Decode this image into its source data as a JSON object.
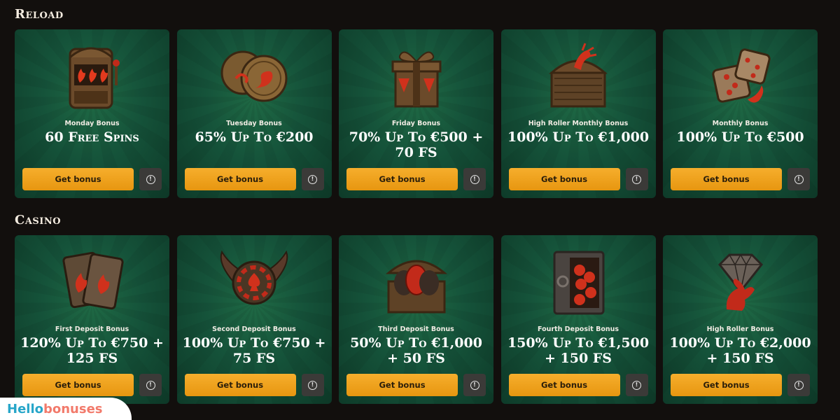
{
  "sections": [
    {
      "title": "Reload",
      "cards": [
        {
          "label": "Monday Bonus",
          "offer": "60 Free Spins",
          "button": "Get bonus",
          "icon": "slot-machine-icon"
        },
        {
          "label": "Tuesday Bonus",
          "offer": "65% Up To €200",
          "button": "Get bonus",
          "icon": "dragon-coins-icon"
        },
        {
          "label": "Friday Bonus",
          "offer": "70% Up To €500 + 70 FS",
          "button": "Get bonus",
          "icon": "gift-box-icon"
        },
        {
          "label": "High Roller Monthly Bonus",
          "offer": "100% Up To €1,000",
          "button": "Get bonus",
          "icon": "treasure-chest-claw-icon"
        },
        {
          "label": "Monthly Bonus",
          "offer": "100% Up To €500",
          "button": "Get bonus",
          "icon": "dice-icon"
        }
      ]
    },
    {
      "title": "Casino",
      "cards": [
        {
          "label": "First Deposit Bonus",
          "offer": "120% Up To €750 + 125 FS",
          "button": "Get bonus",
          "icon": "playing-cards-icon"
        },
        {
          "label": "Second Deposit Bonus",
          "offer": "100% Up To €750 + 75 FS",
          "button": "Get bonus",
          "icon": "winged-chip-icon"
        },
        {
          "label": "Third Deposit Bonus",
          "offer": "50% Up To €1,000 + 50 FS",
          "button": "Get bonus",
          "icon": "egg-chest-icon"
        },
        {
          "label": "Fourth Deposit Bonus",
          "offer": "150% Up To €1,500 + 150 FS",
          "button": "Get bonus",
          "icon": "safe-icon"
        },
        {
          "label": "High Roller Bonus",
          "offer": "100% Up To €2,000 + 150 FS",
          "button": "Get bonus",
          "icon": "diamond-claw-icon"
        }
      ]
    }
  ],
  "logo": {
    "part1": "Hello",
    "part2": "bonuses"
  },
  "colors": {
    "accent": "#f0a21c",
    "card_green": "#15533a",
    "background": "#120f0d"
  }
}
